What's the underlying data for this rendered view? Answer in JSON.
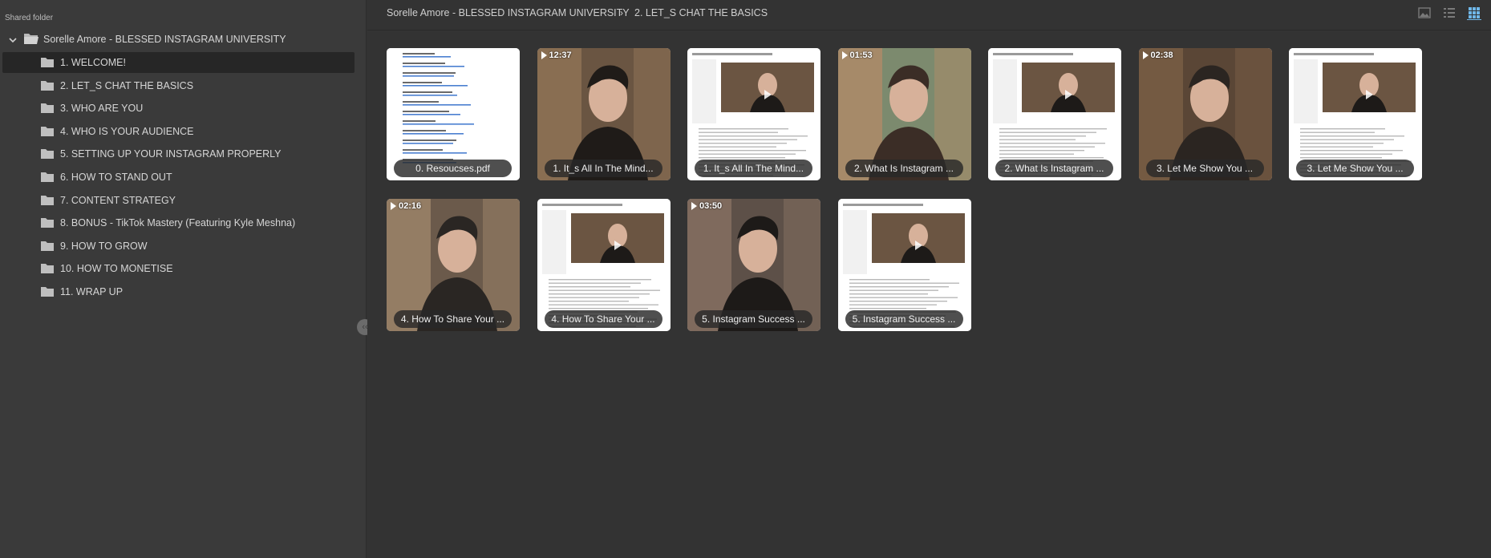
{
  "sidebar": {
    "shared_label": "Shared folder",
    "root_label": "Sorelle Amore - BLESSED INSTAGRAM UNIVERSITY",
    "items": [
      {
        "label": "1. WELCOME!"
      },
      {
        "label": "2. LET_S CHAT THE BASICS"
      },
      {
        "label": "3. WHO ARE YOU"
      },
      {
        "label": "4. WHO IS YOUR AUDIENCE"
      },
      {
        "label": "5. SETTING UP YOUR INSTAGRAM PROPERLY"
      },
      {
        "label": "6. HOW TO STAND OUT"
      },
      {
        "label": "7. CONTENT STRATEGY"
      },
      {
        "label": "8. BONUS - TikTok Mastery (Featuring Kyle Meshna)"
      },
      {
        "label": "9. HOW TO GROW"
      },
      {
        "label": "10. HOW TO MONETISE"
      },
      {
        "label": "11. WRAP UP"
      }
    ],
    "active_index": 0,
    "collapse_glyph": "‹‹"
  },
  "breadcrumb": {
    "root": "Sorelle Amore - BLESSED INSTAGRAM UNIVERSITY",
    "separator": "›",
    "current": "2. LET_S CHAT THE BASICS"
  },
  "view_buttons": [
    {
      "icon": "image-view-icon"
    },
    {
      "icon": "list-view-icon"
    },
    {
      "icon": "grid-view-icon",
      "active": true
    }
  ],
  "files": [
    {
      "caption": "0. Resoucses.pdf",
      "duration": "",
      "kind": "pdf"
    },
    {
      "caption": "1. It_s All In The Mind...",
      "duration": "12:37",
      "kind": "video"
    },
    {
      "caption": "1. It_s All In The Mind...",
      "duration": "",
      "kind": "doc"
    },
    {
      "caption": "2. What Is Instagram ...",
      "duration": "01:53",
      "kind": "video"
    },
    {
      "caption": "2. What Is Instagram ...",
      "duration": "",
      "kind": "doc"
    },
    {
      "caption": "3. Let Me Show You ...",
      "duration": "02:38",
      "kind": "video"
    },
    {
      "caption": "3. Let Me Show You ...",
      "duration": "",
      "kind": "doc"
    },
    {
      "caption": "4. How To Share Your ...",
      "duration": "02:16",
      "kind": "video"
    },
    {
      "caption": "4. How To Share Your ...",
      "duration": "",
      "kind": "doc"
    },
    {
      "caption": "5. Instagram Success ...",
      "duration": "03:50",
      "kind": "video"
    },
    {
      "caption": "5. Instagram Success ...",
      "duration": "",
      "kind": "doc"
    }
  ],
  "colors": {
    "background": "#333333",
    "sidebar": "#3a3a3a",
    "active_item": "#262626",
    "text": "#d6d6d6",
    "accent": "#6fb7e8"
  }
}
